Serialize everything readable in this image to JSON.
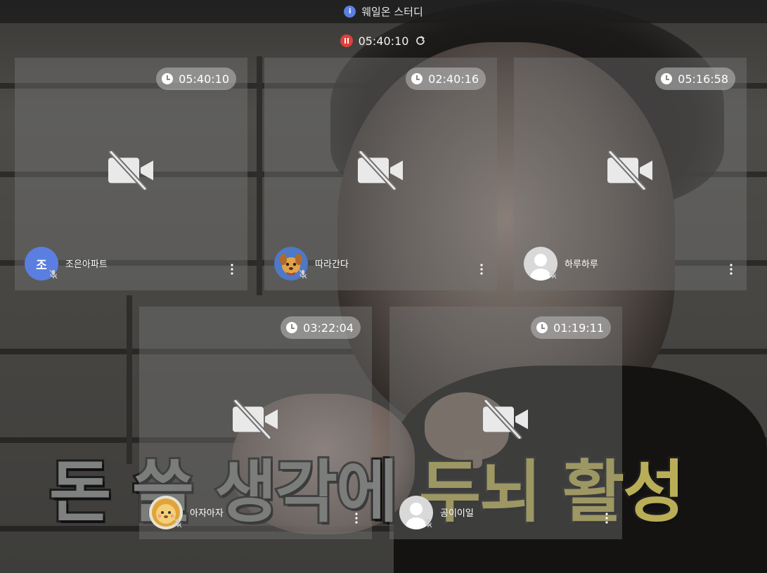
{
  "header": {
    "title": "웨일온 스터디",
    "info_icon": "info-icon"
  },
  "timer": {
    "value": "05:40:10",
    "pause_icon": "pause-icon",
    "refresh_icon": "refresh-icon"
  },
  "background": {
    "caption_part1": "돈 쓸 생각에 ",
    "caption_part2": "두뇌 활성"
  },
  "colors": {
    "accent_blue": "#5b7fe0",
    "record_red": "#e0413a",
    "caption_highlight": "#b9ae57"
  },
  "participants": [
    {
      "name": "조은아파트",
      "time": "05:40:10",
      "avatar_type": "letter",
      "avatar_letter": "조",
      "camera": "off",
      "mic": "off"
    },
    {
      "name": "따라간다",
      "time": "02:40:16",
      "avatar_type": "character-dog",
      "camera": "off",
      "mic": "off"
    },
    {
      "name": "하루하루",
      "time": "05:16:58",
      "avatar_type": "default-person",
      "camera": "off",
      "mic": "off"
    },
    {
      "name": "아자아자",
      "time": "03:22:04",
      "avatar_type": "character-lion",
      "camera": "off",
      "mic": "off"
    },
    {
      "name": "공이이일",
      "time": "01:19:11",
      "avatar_type": "default-person",
      "camera": "off",
      "mic": "off"
    }
  ]
}
